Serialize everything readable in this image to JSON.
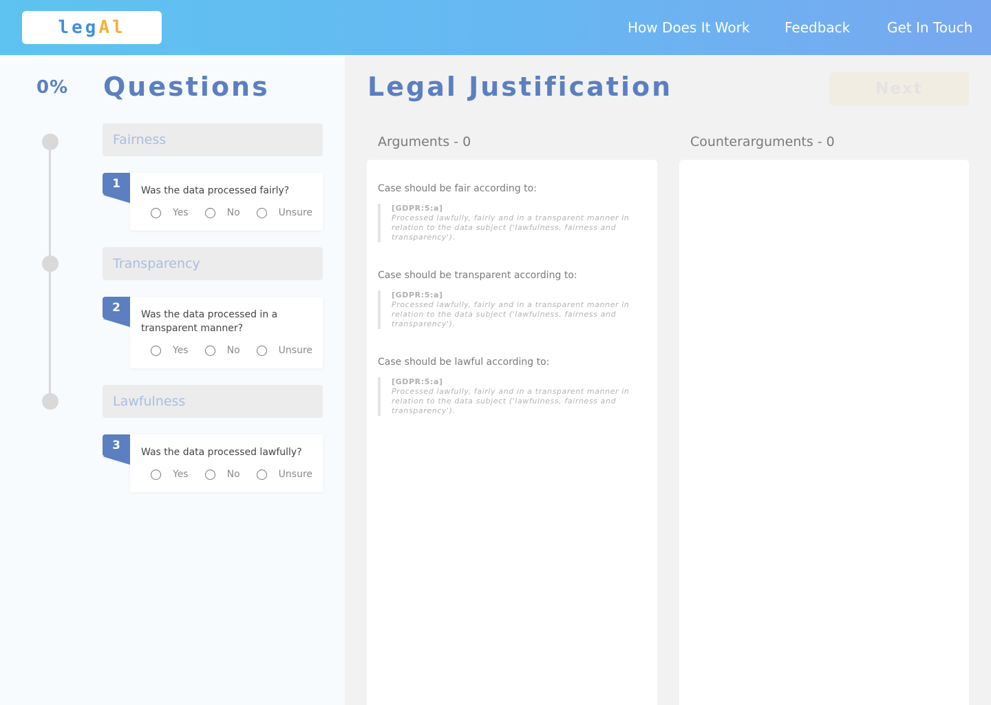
{
  "header": {
    "logo_part1": "leg",
    "logo_part2": "A",
    "logo_part3": "l",
    "nav": [
      "How Does It Work",
      "Feedback",
      "Get In Touch"
    ]
  },
  "progress": {
    "percent_label": "0%"
  },
  "questions": {
    "title": "Questions",
    "sections": [
      {
        "header": "Fairness",
        "number": "1",
        "question": "Was the data processed fairly?",
        "options": [
          "Yes",
          "No",
          "Unsure"
        ]
      },
      {
        "header": "Transparency",
        "number": "2",
        "question": "Was the data processed in a transparent manner?",
        "options": [
          "Yes",
          "No",
          "Unsure"
        ]
      },
      {
        "header": "Lawfulness",
        "number": "3",
        "question": "Was the data processed lawfully?",
        "options": [
          "Yes",
          "No",
          "Unsure"
        ]
      }
    ]
  },
  "justification": {
    "title": "Legal Justification",
    "next_label": "Next",
    "arguments_label": "Arguments - 0",
    "counterarguments_label": "Counterarguments - 0",
    "arguments": [
      {
        "title": "Case should be fair according to:",
        "ref": "[GDPR:5:a]",
        "text": "Processed lawfully, fairly and in a transparent manner in relation to the data subject ('lawfulness, fairness and transparency')."
      },
      {
        "title": "Case should be transparent according to:",
        "ref": "[GDPR:5:a]",
        "text": "Processed lawfully, fairly and in a transparent manner in relation to the data subject ('lawfulness, fairness and transparency')."
      },
      {
        "title": "Case should be lawful according to:",
        "ref": "[GDPR:5:a]",
        "text": "Processed lawfully, fairly and in a transparent manner in relation to the data subject ('lawfulness, fairness and transparency')."
      }
    ]
  },
  "colors": {
    "accent": "#5b7fc0",
    "header_start": "#5ec3f0",
    "header_end": "#78a8f0",
    "logo_blue": "#3f8fe0",
    "logo_orange": "#f2b23c"
  }
}
